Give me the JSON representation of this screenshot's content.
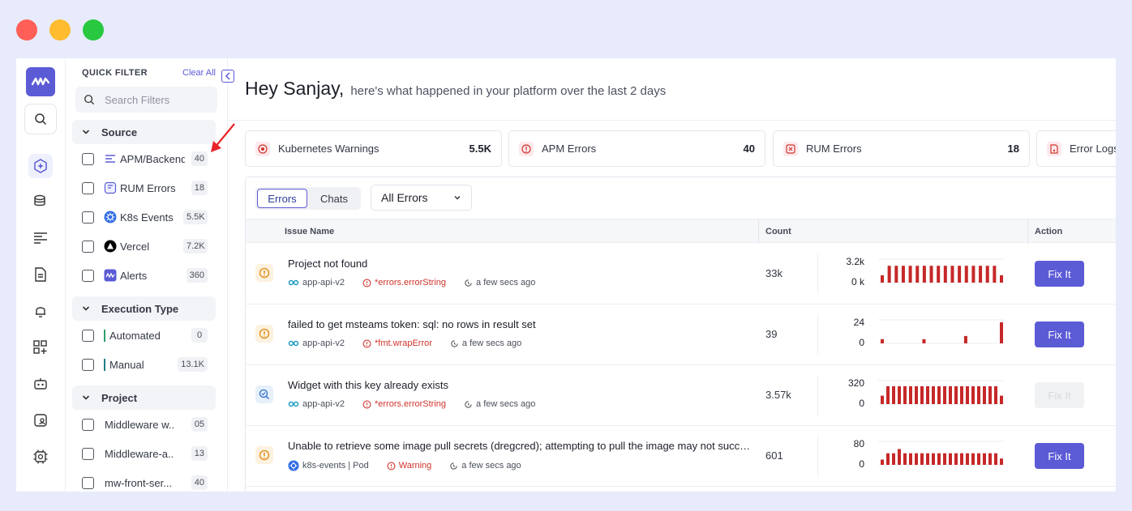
{
  "colors": {
    "accent": "#5b5bd6",
    "error": "#d0342c",
    "bars": "#c62828"
  },
  "window_controls": [
    "close",
    "minimize",
    "maximize"
  ],
  "filter": {
    "title": "QUICK FILTER",
    "clear_all": "Clear All",
    "search_placeholder": "Search Filters",
    "groups": [
      {
        "label": "Source",
        "items": [
          {
            "label": "APM/Backend",
            "count": "40",
            "icon": "apm-icon"
          },
          {
            "label": "RUM Errors",
            "count": "18",
            "icon": "rum-icon"
          },
          {
            "label": "K8s Events",
            "count": "5.5K",
            "icon": "kubernetes-icon"
          },
          {
            "label": "Vercel",
            "count": "7.2K",
            "icon": "vercel-icon"
          },
          {
            "label": "Alerts",
            "count": "360",
            "icon": "alerts-icon"
          }
        ]
      },
      {
        "label": "Execution Type",
        "items": [
          {
            "label": "Automated",
            "count": "0",
            "color": "#2e9e6b"
          },
          {
            "label": "Manual",
            "count": "13.1K",
            "color": "#1e7f86"
          }
        ]
      },
      {
        "label": "Project",
        "items": [
          {
            "label": "Middleware w...",
            "count": "05"
          },
          {
            "label": "Middleware-a...",
            "count": "13"
          },
          {
            "label": "mw-front-ser...",
            "count": "40"
          }
        ]
      }
    ]
  },
  "greeting": {
    "name": "Hey Sanjay,",
    "subtitle": "here's what happened in your platform over the last 2 days"
  },
  "summary_cards": [
    {
      "label": "Kubernetes Warnings",
      "value": "5.5K"
    },
    {
      "label": "APM Errors",
      "value": "40"
    },
    {
      "label": "RUM Errors",
      "value": "18"
    },
    {
      "label": "Error Logs",
      "value": ""
    }
  ],
  "tabs": {
    "errors": "Errors",
    "chats": "Chats"
  },
  "dropdown": {
    "selected": "All Errors"
  },
  "table": {
    "headers": {
      "issue": "Issue Name",
      "count": "Count",
      "action": "Action"
    },
    "fix_label": "Fix It",
    "rows": [
      {
        "severity": "warning",
        "issue": "Project not found",
        "service": "app-api-v2",
        "error": "*errors.errorString",
        "time": "a few secs ago",
        "count": "33k",
        "max": "3.2k",
        "min": "0 k",
        "bars": [
          0.35,
          0.8,
          0.8,
          0.8,
          0.8,
          0.8,
          0.8,
          0.8,
          0.8,
          0.8,
          0.8,
          0.8,
          0.8,
          0.8,
          0.8,
          0.8,
          0.8,
          0.35
        ],
        "fixable": true,
        "source": "apm"
      },
      {
        "severity": "warning",
        "issue": "failed to get msteams token: sql: no rows in result set",
        "service": "app-api-v2",
        "error": "*fmt.wrapError",
        "time": "a few secs ago",
        "count": "39",
        "max": "24",
        "min": "0",
        "bars": [
          0.2,
          0,
          0,
          0,
          0,
          0,
          0,
          0.2,
          0,
          0,
          0,
          0,
          0,
          0,
          0.35,
          0,
          0,
          0,
          0,
          0,
          1.0
        ],
        "fixable": true,
        "source": "apm"
      },
      {
        "severity": "info",
        "issue": "Widget with this key already exists",
        "service": "app-api-v2",
        "error": "*errors.errorString",
        "time": "a few secs ago",
        "count": "3.57k",
        "max": "320",
        "min": "0",
        "bars": [
          0.4,
          0.85,
          0.85,
          0.85,
          0.85,
          0.85,
          0.85,
          0.85,
          0.85,
          0.85,
          0.85,
          0.85,
          0.85,
          0.85,
          0.85,
          0.85,
          0.85,
          0.85,
          0.85,
          0.85,
          0.85,
          0.4
        ],
        "fixable": false,
        "source": "apm"
      },
      {
        "severity": "warning",
        "issue": "Unable to retrieve some image pull secrets (dregcred); attempting to pull the image may not succeed",
        "service": "k8s-events | Pod",
        "error": "Warning",
        "time": "a few secs ago",
        "count": "601",
        "max": "80",
        "min": "0",
        "bars": [
          0.25,
          0.55,
          0.55,
          0.75,
          0.55,
          0.55,
          0.55,
          0.55,
          0.55,
          0.55,
          0.55,
          0.55,
          0.55,
          0.55,
          0.55,
          0.55,
          0.55,
          0.55,
          0.55,
          0.55,
          0.55,
          0.3
        ],
        "fixable": true,
        "source": "k8s"
      }
    ]
  }
}
